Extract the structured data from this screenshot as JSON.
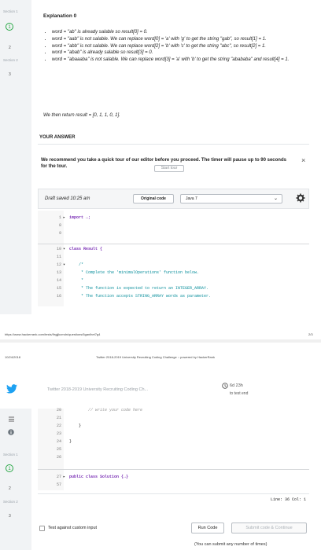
{
  "top": {
    "gutter": {
      "section1": "Section 1",
      "num1": "1",
      "num2": "2",
      "section2": "Section 2",
      "num3": "3"
    },
    "explanation": {
      "title": "Explanation 0",
      "bullets": [
        "word = \"ab\" is already salable so result[0] = 0.",
        "word = \"aab\" is not salable. We can replace word[0] = 'a' with 'g' to get the string \"gab\", so result[1] = 1.",
        "word = \"abb\" is not salable. We can replace word[2] = 'b' with 'c' to get the string \"abc\", so result[2] = 1.",
        "word = \"abab\" is already salable so result[3] = 0.",
        "word = \"abaaaba\" is not salable. We can replace word[3] = 'a' with 'b' to get the string \"abababa\" and result[4] = 1."
      ],
      "return_text": "We then return result = [0, 1, 1, 0, 1]."
    },
    "your_answer": "YOUR ANSWER",
    "tour": {
      "text": "We recommend you take a quick tour of our editor before you proceed. The timer will pause up to 90 seconds for the tour.",
      "button": "Start tour",
      "close": "×"
    },
    "editor": {
      "draft_saved": "Draft saved 10:25 am",
      "original_code": "Original code",
      "language": "Java 7"
    },
    "code_lines": [
      {
        "n": "1",
        "text": "import ↔;"
      },
      {
        "n": "8",
        "text": ""
      },
      {
        "n": "9",
        "text": ""
      },
      {
        "n": "10",
        "text": "class Result {"
      },
      {
        "n": "11",
        "text": ""
      },
      {
        "n": "12",
        "text": "    /*"
      },
      {
        "n": "13",
        "text": "     * Complete the 'minimalOperations' function below."
      },
      {
        "n": "14",
        "text": "     *"
      },
      {
        "n": "15",
        "text": "     * The function is expected to return an INTEGER_ARRAY."
      },
      {
        "n": "16",
        "text": "     * The function accepts STRING_ARRAY words as parameter."
      }
    ],
    "footer_url": "https://www.hackerrank.com/tests/9rgjjkcmdn/questions/6ganlhet7g4",
    "footer_page": "2/3"
  },
  "bottom": {
    "header_date": "10/24/2018",
    "header_title": "Twitter 2018-2019 University Recruiting Coding Challenge :: powered by HackerRank",
    "contest_name": "Twitter 2018-2019 University Recruiting Coding Ch...",
    "timer": "6d 23h",
    "timer_sub": "to test end",
    "gutter": {
      "section1": "Section 1",
      "num1": "1",
      "num2": "2",
      "section2": "Section 2",
      "num3": "3"
    },
    "code_lines": [
      {
        "n": "20",
        "text": "        // write your code here"
      },
      {
        "n": "21",
        "text": ""
      },
      {
        "n": "22",
        "text": "    }"
      },
      {
        "n": "23",
        "text": ""
      },
      {
        "n": "24",
        "text": "}"
      },
      {
        "n": "25",
        "text": ""
      },
      {
        "n": "26",
        "text": ""
      },
      {
        "n": "27",
        "text": "public class Solution {↔}"
      },
      {
        "n": "57",
        "text": ""
      }
    ],
    "line_col": "Line: 36 Col: 1",
    "test_custom": "Test against custom input",
    "run_code": "Run Code",
    "submit": "Submit code & Continue",
    "note": "(You can submit any number of times)"
  }
}
